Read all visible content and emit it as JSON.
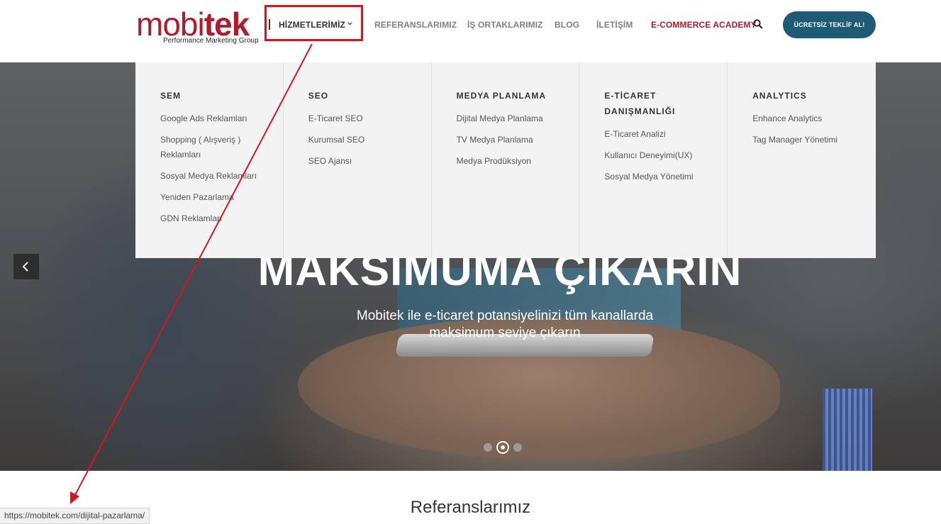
{
  "logo": {
    "word_a": "mobi",
    "word_b": "tek",
    "tagline": "Performance Marketing Group"
  },
  "nav": {
    "items": [
      {
        "label": "HİZMETLERİMİZ"
      },
      {
        "label": "REFERANSLARIMIZ"
      },
      {
        "label": "İŞ ORTAKLARIMIZ"
      },
      {
        "label": "BLOG"
      },
      {
        "label": "İLETİŞİM"
      },
      {
        "label": "E-COMMERCE ACADEMY"
      }
    ],
    "cta_label": "ÜCRETSİZ TEKLİF AL!"
  },
  "mega_menu": {
    "columns": [
      {
        "title": "SEM",
        "links": [
          "Google Ads Reklamları",
          "Shopping ( Alışveriş ) Reklamları",
          "Sosyal Medya Reklamları",
          "Yeniden Pazarlama",
          "GDN Reklamları"
        ]
      },
      {
        "title": "SEO",
        "links": [
          "E-Ticaret SEO",
          "Kurumsal SEO",
          "SEO Ajansı"
        ]
      },
      {
        "title": "MEDYA PLANLAMA",
        "links": [
          "Dijital Medya Planlama",
          "TV Medya Planlama",
          "Medya Prodüksiyon"
        ]
      },
      {
        "title": "E-TİCARET DANIŞMANLIĞI",
        "links": [
          "E-Ticaret Analizi",
          "Kullanıcı Deneyimi(UX)",
          "Sosyal Medya Yönetimi"
        ]
      },
      {
        "title": "ANALYTICS",
        "links": [
          "Enhance Analytics",
          "Tag Manager Yönetimi"
        ]
      }
    ]
  },
  "hero": {
    "headline": "MAKSİMUMA ÇIKARIN",
    "subtitle": "Mobitek ile e-ticaret potansiyelinizi tüm kanallarda maksimum seviye çıkarın",
    "slides_total": 3,
    "active_slide": 2
  },
  "section": {
    "title": "Referanslarımız"
  },
  "status_bar": {
    "url": "https://mobitek.com/dijital-pazarlama/"
  },
  "colors": {
    "brand_red": "#b01c2e",
    "cta_blue": "#1e5b74",
    "annotation_red": "#d9141b"
  },
  "icons": {
    "nav_dropdown": "chevron-down-icon",
    "search": "search-icon",
    "slider_prev": "chevron-left-icon"
  }
}
